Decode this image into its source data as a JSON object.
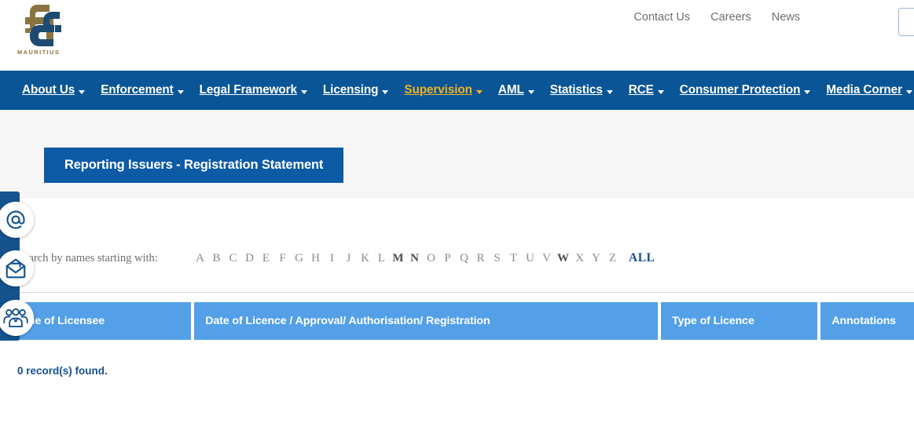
{
  "header": {
    "logo": {
      "name": "fsc-mauritius-logo",
      "wordmark": "MAURITIUS",
      "gold": "#8b7340",
      "navy": "#1c4a72"
    },
    "top_links": [
      {
        "label": "Contact Us",
        "name": "contact-us-link"
      },
      {
        "label": "Careers",
        "name": "careers-link"
      },
      {
        "label": "News",
        "name": "news-link"
      }
    ],
    "search": {
      "value": "",
      "placeholder": ""
    }
  },
  "mainnav": {
    "background": "#0a5596",
    "active_color": "#f0b323",
    "items": [
      {
        "label": "About Us",
        "caret": true,
        "active": false
      },
      {
        "label": "Enforcement",
        "caret": true,
        "active": false
      },
      {
        "label": "Legal Framework",
        "caret": true,
        "active": false
      },
      {
        "label": "Licensing",
        "caret": true,
        "active": false
      },
      {
        "label": "Supervision",
        "caret": true,
        "active": true
      },
      {
        "label": "AML",
        "caret": true,
        "active": false
      },
      {
        "label": "Statistics",
        "caret": true,
        "active": false
      },
      {
        "label": "RCE",
        "caret": true,
        "active": false
      },
      {
        "label": "Consumer Protection",
        "caret": true,
        "active": false
      },
      {
        "label": "Media Corner",
        "caret": true,
        "active": false
      }
    ]
  },
  "page": {
    "title": "Reporting Issuers - Registration Statement",
    "title_bg": "#0d5ba5"
  },
  "search_by_letter": {
    "label": "Search by names starting with:",
    "letters": [
      {
        "c": "A",
        "highlight": false
      },
      {
        "c": "B",
        "highlight": false
      },
      {
        "c": "C",
        "highlight": false
      },
      {
        "c": "D",
        "highlight": false
      },
      {
        "c": "E",
        "highlight": false
      },
      {
        "c": "F",
        "highlight": false
      },
      {
        "c": "G",
        "highlight": false
      },
      {
        "c": "H",
        "highlight": false
      },
      {
        "c": "I",
        "highlight": false
      },
      {
        "c": "J",
        "highlight": false
      },
      {
        "c": "K",
        "highlight": false
      },
      {
        "c": "L",
        "highlight": false
      },
      {
        "c": "M",
        "highlight": true
      },
      {
        "c": "N",
        "highlight": true
      },
      {
        "c": "O",
        "highlight": false
      },
      {
        "c": "P",
        "highlight": false
      },
      {
        "c": "Q",
        "highlight": false
      },
      {
        "c": "R",
        "highlight": false
      },
      {
        "c": "S",
        "highlight": false
      },
      {
        "c": "T",
        "highlight": false
      },
      {
        "c": "U",
        "highlight": false
      },
      {
        "c": "V",
        "highlight": false
      },
      {
        "c": "W",
        "highlight": true
      },
      {
        "c": "X",
        "highlight": false
      },
      {
        "c": "Y",
        "highlight": false
      },
      {
        "c": "Z",
        "highlight": false
      }
    ],
    "all_label": "ALL"
  },
  "table": {
    "header_bg": "#53a0e8",
    "columns": [
      {
        "label": "Name of Licensee",
        "name": "column-header-name-of-licensee"
      },
      {
        "label": "Date of Licence / Approval/ Authorisation/ Registration",
        "name": "column-header-date"
      },
      {
        "label": "Type of Licence",
        "name": "column-header-type-of-licence"
      },
      {
        "label": "Annotations",
        "name": "column-header-annotations"
      }
    ],
    "rows": [],
    "records_found": "0 record(s) found."
  },
  "side_widgets": {
    "strip_color": "#15538f",
    "buttons": [
      {
        "name": "at-sign-icon",
        "label": "at-sign"
      },
      {
        "name": "envelope-icon",
        "label": "envelope"
      },
      {
        "name": "people-group-icon",
        "label": "people-group"
      }
    ]
  }
}
